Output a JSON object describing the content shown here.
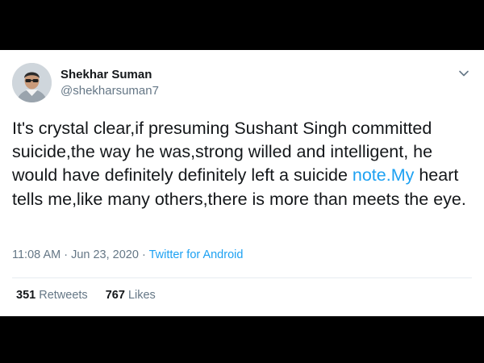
{
  "tweet": {
    "author": {
      "name": "Shekhar Suman",
      "handle": "@shekharsuman7"
    },
    "text_part1": "It's crystal clear,if presuming Sushant Singh committed suicide,the way he was,strong willed and intelligent, he would have definitely definitely left a suicide ",
    "text_link": "note.My",
    "text_part2": " heart tells me,like many others,there is more than meets the eye.",
    "timestamp": "11:08 AM · Jun 23, 2020",
    "separator": " · ",
    "source": "Twitter for Android",
    "retweets_count": "351",
    "retweets_label": "Retweets",
    "likes_count": "767",
    "likes_label": "Likes"
  },
  "icons": {
    "menu": "chevron-down-icon",
    "avatar": "profile-photo"
  },
  "colors": {
    "background": "#000000",
    "card": "#ffffff",
    "text": "#14171a",
    "secondary": "#657786",
    "link": "#1da1f2"
  }
}
